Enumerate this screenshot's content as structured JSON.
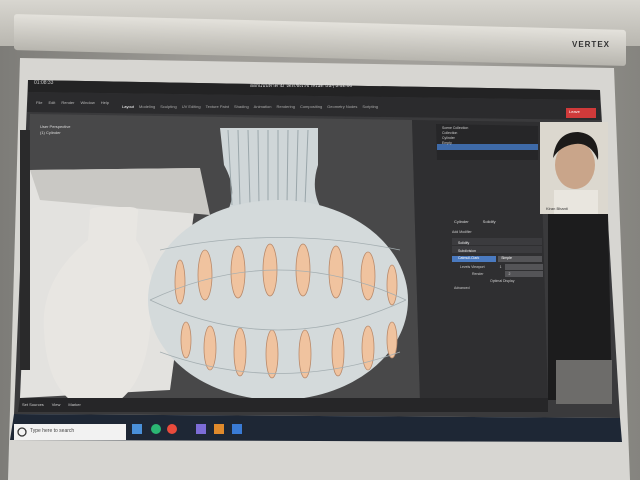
{
  "projector": {
    "brand": "VERTEX"
  },
  "app": {
    "time": "01:08:33",
    "window_title": "ออกแบบทำตาม โต๊ะเชิงเรขาคณิต ปั้นๆ 3.12.66",
    "menus": [
      "File",
      "Edit",
      "Render",
      "Window",
      "Help"
    ],
    "workspace_tabs": [
      "Layout",
      "Modeling",
      "Sculpting",
      "UV Editing",
      "Texture Paint",
      "Shading",
      "Animation",
      "Rendering",
      "Compositing",
      "Geometry Nodes",
      "Scripting"
    ],
    "viewport_header": [
      "User Perspective",
      "(1) Cylinder"
    ],
    "status_left": "Set Sources",
    "status_buttons": [
      "View",
      "Marker"
    ],
    "leave_button": "Leave"
  },
  "properties": {
    "tabs": [
      "Cylinder",
      "Solidify"
    ],
    "add_modifier": "Add Modifier",
    "modifiers": [
      "Solidify",
      "Subdivision"
    ],
    "sub_tabs": [
      "Catmull-Clark",
      "Simple"
    ],
    "fields": [
      {
        "label": "Levels Viewport",
        "value": "1"
      },
      {
        "label": "Render",
        "value": "2"
      }
    ],
    "optimal_display": "Optimal Display",
    "advanced": "Advanced"
  },
  "outliner": [
    "Scene Collection",
    "Collection",
    "Cylinder",
    "Empty"
  ],
  "participant": {
    "name": "Kiran Bhanti"
  },
  "taskbar": {
    "search_placeholder": "Type here to search"
  }
}
